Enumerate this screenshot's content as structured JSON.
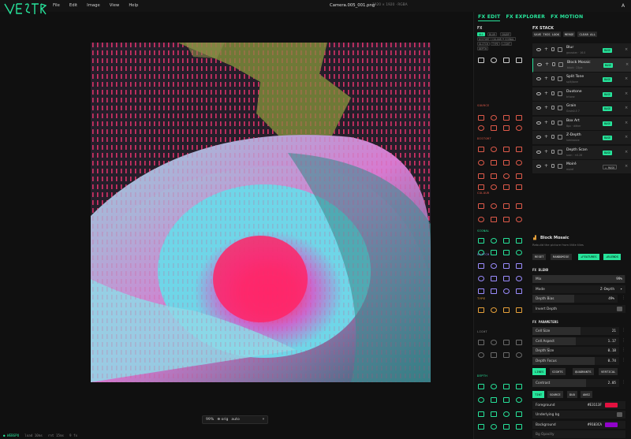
{
  "app": {
    "logo": "VESTIR"
  },
  "menu": [
    "File",
    "Edit",
    "Image",
    "View",
    "Help"
  ],
  "document": {
    "title": "Camera.005_001.png",
    "meta": "1920 × 1920 · RGBA"
  },
  "avatar": "A",
  "right_tabs": [
    {
      "label": "FX EDIT",
      "active": true
    },
    {
      "label": "FX EXPLORER",
      "active": false
    },
    {
      "label": "FX MOTION",
      "active": false
    }
  ],
  "fx_library": {
    "title": "FX",
    "chips": [
      "ALL",
      "BLUR",
      "SHARP",
      "DISTORT",
      "COLOUR",
      "SIGNAL",
      "GLITCH",
      "TYPE",
      "LIGHT",
      "DEPTH"
    ],
    "sections": [
      "SOURCE",
      "DISTORT",
      "COLOUR",
      "SIGNAL",
      "GLITCH",
      "TYPE",
      "LIGHT",
      "DEPTH"
    ]
  },
  "fx_stack": {
    "title": "FX STACK",
    "buttons": [
      "SAVE THIS LOOK",
      "MERGE",
      "CLEAR ALL"
    ],
    "layers": [
      {
        "name": "Blur",
        "sub": "gaussian · 16.0",
        "mode": "BASE"
      },
      {
        "name": "Block Mosaic",
        "sub": "block · 21px",
        "mode": "BASE"
      },
      {
        "name": "Split Tone",
        "sub": "split/tone",
        "mode": "BASE"
      },
      {
        "name": "Duotone",
        "sub": "tritone",
        "mode": "BASE"
      },
      {
        "name": "Grain",
        "sub": "Grain0.5 7",
        "mode": "BASE"
      },
      {
        "name": "Box Art",
        "sub": "8px · dither",
        "mode": "BASE"
      },
      {
        "name": "Z-Depth",
        "sub": "luminance",
        "mode": "BASE"
      },
      {
        "name": "Depth Scan",
        "sub": "scan · ✕0.26",
        "mode": "BASE"
      },
      {
        "name": "Moiré",
        "sub": "moiré",
        "mode": "+ MASK"
      }
    ]
  },
  "detail": {
    "name": "Block Mosaic",
    "description": "Rebuild the picture from little tiles",
    "buttons": [
      "RESET",
      "RANDOMISE",
      "+FEATURES",
      "+BLENDS"
    ],
    "blend": {
      "title": "FX BLEND",
      "mix_label": "Mix",
      "mix_value": "99%",
      "mix_fraction": 0.99,
      "mode_label": "Mode",
      "mode_value": "Z-Depth",
      "depth_bias_label": "Depth Bias",
      "depth_bias_value": "49%",
      "depth_bias_fraction": 0.49,
      "invert_depth_label": "Invert Depth"
    },
    "params": {
      "title": "FX PARAMETERS",
      "rows": [
        {
          "label": "Cell Size",
          "value": "21",
          "fraction": 0.55
        },
        {
          "label": "Cell Aspect",
          "value": "1.17",
          "fraction": 0.5
        },
        {
          "label": "Depth Size",
          "value": "0.18",
          "fraction": 0.2
        },
        {
          "label": "Depth Focus",
          "value": "0.74",
          "fraction": 0.72
        }
      ],
      "shape_options": [
        "LINES",
        "SIGHTS",
        "QUADRANTS",
        "VERTICAL"
      ],
      "contrast_label": "Contrast",
      "contrast_value": "2.05",
      "contrast_fraction": 0.62,
      "colour_options": [
        "TINT",
        "SOURCE",
        "DUO",
        "ANSI"
      ],
      "foreground_label": "Foreground",
      "foreground_value": "#E3113F",
      "underlying_bg_label": "Underlying bg",
      "background_label": "Background",
      "background_value": "#9103CA",
      "bg_opacity_label": "Bg Opacity"
    }
  },
  "zoom": {
    "percent": "99%",
    "orig_label": "⊕ orig",
    "mode": "auto"
  },
  "status": {
    "gpu": "● WEBGPU",
    "load": "load 10ms",
    "render": "rnt 15ms",
    "fx_count": "9 fx"
  },
  "colors": {
    "accent": "#27e49b",
    "foreground": "#E3113F",
    "background": "#9103CA"
  }
}
